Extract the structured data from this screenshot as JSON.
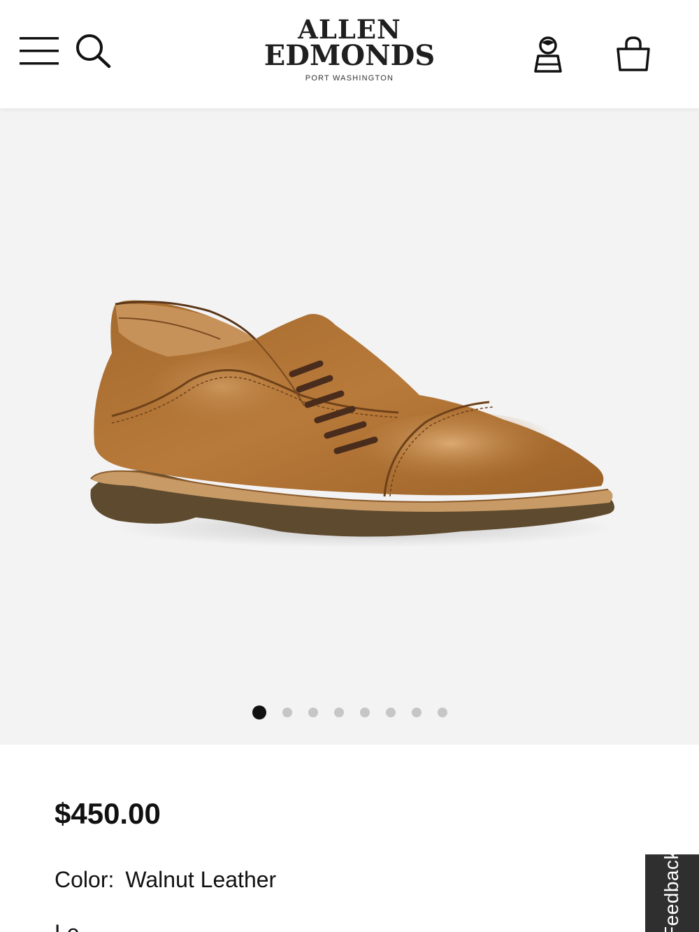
{
  "header": {
    "brand_line1": "ALLEN",
    "brand_line2": "EDMONDS",
    "brand_sub": "PORT WASHINGTON",
    "icons": [
      "menu-icon",
      "search-icon",
      "account-icon",
      "shopping-bag-icon"
    ]
  },
  "gallery": {
    "image": "walnut leather cap-toe oxford shoe",
    "slide_count": 8,
    "active_slide": 1
  },
  "product": {
    "price": "$450.00",
    "color_label": "Color:",
    "color_value": "Walnut Leather",
    "next_label_partial": "Le"
  },
  "feedback_tab": {
    "label": "Feedback"
  },
  "colors": {
    "gallery_bg": "#f3f3f4",
    "active_dot": "#111111",
    "inactive_dot": "#c6c6c8",
    "feedback_bg": "#2f2f2f"
  }
}
